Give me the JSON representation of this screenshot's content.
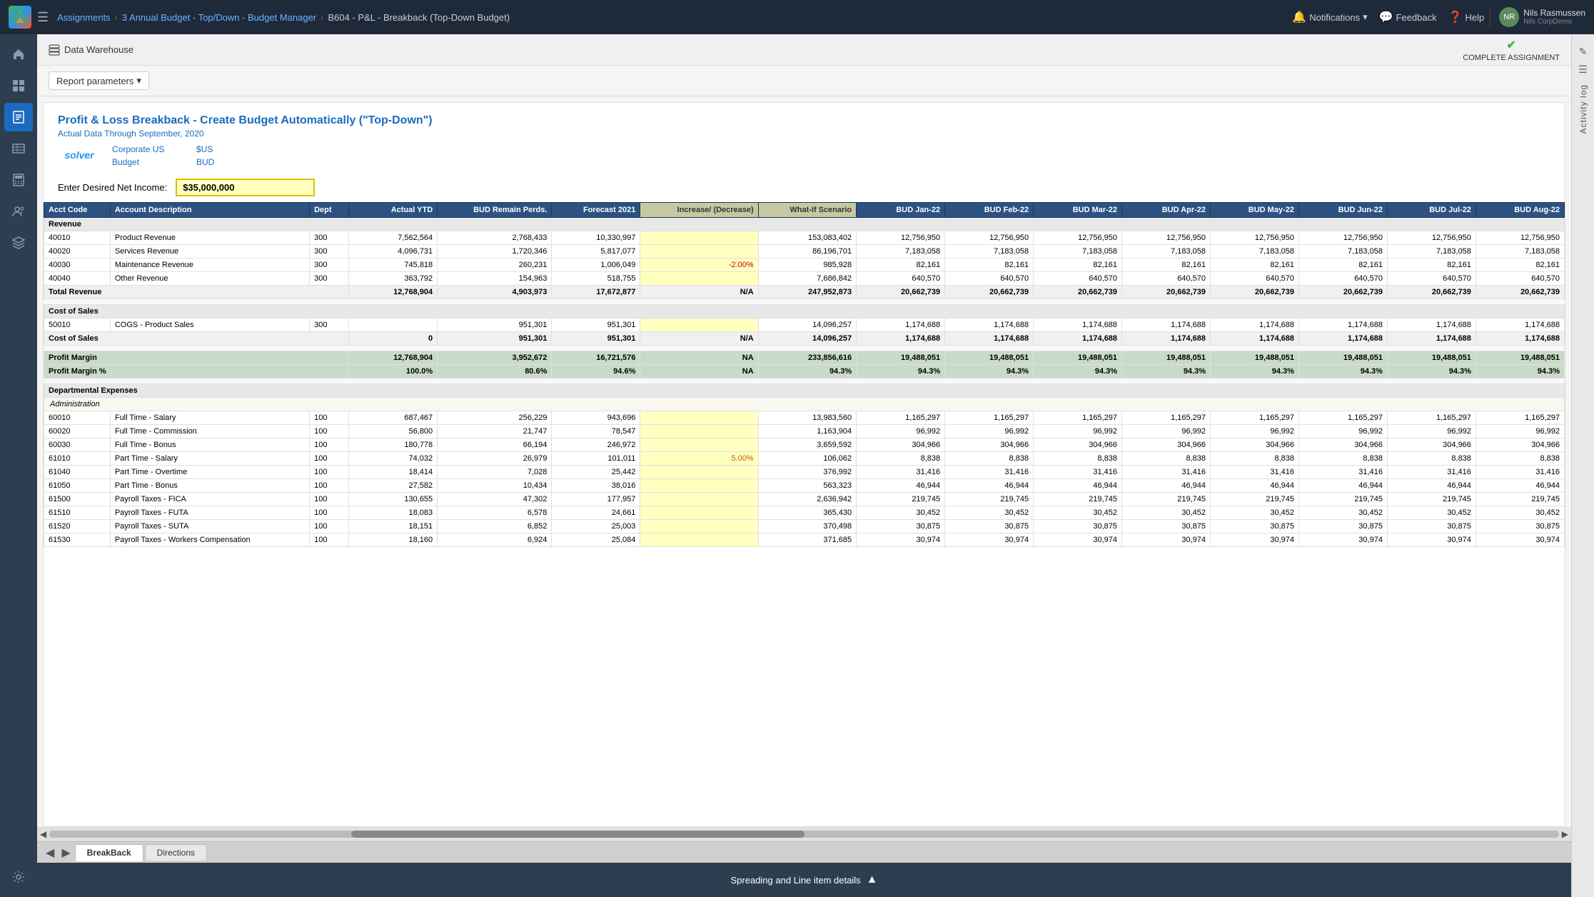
{
  "topnav": {
    "logo_text": "S",
    "hamburger": "☰",
    "breadcrumb": [
      {
        "label": "Assignments",
        "id": "assignments"
      },
      {
        "sep": ">"
      },
      {
        "label": "3 Annual Budget - Top/Down - Budget Manager",
        "id": "budget"
      },
      {
        "sep": ">"
      },
      {
        "label": "B604 - P&L - Breakback (Top-Down Budget)",
        "id": "current"
      }
    ],
    "notifications_label": "Notifications",
    "feedback_label": "Feedback",
    "help_label": "Help",
    "user_name": "Nils Rasmussen",
    "user_org": "Nils CorpDemo"
  },
  "toolbar": {
    "data_warehouse": "Data Warehouse",
    "complete_assignment": "COMPLETE ASSIGNMENT"
  },
  "activity_log": {
    "label": "Activity log"
  },
  "report_params": {
    "label": "Report parameters"
  },
  "report": {
    "title": "Profit & Loss Breakback - Create Budget Automatically (\"Top-Down\")",
    "subtitle": "Actual Data Through September, 2020",
    "company_label": "Corporate US",
    "company_code": "$US",
    "budget_label": "Budget",
    "budget_code": "BUD",
    "net_income_label": "Enter Desired Net Income:",
    "net_income_value": "$35,000,000",
    "columns": {
      "acct_code": "Acct Code",
      "acct_desc": "Account Description",
      "dept": "Dept",
      "actual_ytd": "Actual YTD",
      "bud_remain": "BUD Remain Perds.",
      "forecast_2021": "Forecast 2021",
      "increase_decrease": "Increase/ (Decrease)",
      "what_if": "What-If Scenario",
      "bud_jan22": "BUD Jan-22",
      "bud_feb22": "BUD Feb-22",
      "bud_mar22": "BUD Mar-22",
      "bud_apr22": "BUD Apr-22",
      "bud_may22": "BUD May-22",
      "bud_jun22": "BUD Jun-22",
      "bud_jul22": "BUD Jul-22",
      "bud_aug22": "BUD Aug-22"
    },
    "sections": {
      "revenue": {
        "header": "Revenue",
        "rows": [
          {
            "code": "40010",
            "desc": "Product Revenue",
            "dept": "300",
            "actual_ytd": "7,562,564",
            "bud_remain": "2,768,433",
            "forecast": "10,330,997",
            "increase": "",
            "whatif": "153,083,402",
            "jan": "12,756,950",
            "feb": "12,756,950",
            "mar": "12,756,950",
            "apr": "12,756,950",
            "may": "12,756,950",
            "jun": "12,756,950",
            "jul": "12,756,950",
            "aug": "12,756,950"
          },
          {
            "code": "40020",
            "desc": "Services Revenue",
            "dept": "300",
            "actual_ytd": "4,096,731",
            "bud_remain": "1,720,346",
            "forecast": "5,817,077",
            "increase": "",
            "whatif": "86,196,701",
            "jan": "7,183,058",
            "feb": "7,183,058",
            "mar": "7,183,058",
            "apr": "7,183,058",
            "may": "7,183,058",
            "jun": "7,183,058",
            "jul": "7,183,058",
            "aug": "7,183,058"
          },
          {
            "code": "40030",
            "desc": "Maintenance Revenue",
            "dept": "300",
            "actual_ytd": "745,818",
            "bud_remain": "260,231",
            "forecast": "1,006,049",
            "increase": "-2.00%",
            "whatif": "985,928",
            "jan": "82,161",
            "feb": "82,161",
            "mar": "82,161",
            "apr": "82,161",
            "may": "82,161",
            "jun": "82,161",
            "jul": "82,161",
            "aug": "82,161"
          },
          {
            "code": "40040",
            "desc": "Other Revenue",
            "dept": "300",
            "actual_ytd": "363,792",
            "bud_remain": "154,963",
            "forecast": "518,755",
            "increase": "",
            "whatif": "7,686,842",
            "jan": "640,570",
            "feb": "640,570",
            "mar": "640,570",
            "apr": "640,570",
            "may": "640,570",
            "jun": "640,570",
            "jul": "640,570",
            "aug": "640,570"
          }
        ],
        "total": {
          "label": "Total Revenue",
          "actual_ytd": "12,768,904",
          "bud_remain": "4,903,973",
          "forecast": "17,672,877",
          "increase": "N/A",
          "whatif": "247,952,873",
          "jan": "20,662,739",
          "feb": "20,662,739",
          "mar": "20,662,739",
          "apr": "20,662,739",
          "may": "20,662,739",
          "jun": "20,662,739",
          "jul": "20,662,739",
          "aug": "20,662,739"
        }
      },
      "cost_of_sales": {
        "header": "Cost of Sales",
        "rows": [
          {
            "code": "50010",
            "desc": "COGS - Product Sales",
            "dept": "300",
            "actual_ytd": "",
            "bud_remain": "951,301",
            "forecast": "951,301",
            "increase": "",
            "whatif": "14,096,257",
            "jan": "1,174,688",
            "feb": "1,174,688",
            "mar": "1,174,688",
            "apr": "1,174,688",
            "may": "1,174,688",
            "jun": "1,174,688",
            "jul": "1,174,688",
            "aug": "1,174,688"
          }
        ],
        "total": {
          "label": "Cost of Sales",
          "actual_ytd": "0",
          "bud_remain": "951,301",
          "forecast": "951,301",
          "increase": "N/A",
          "whatif": "14,096,257",
          "jan": "1,174,688",
          "feb": "1,174,688",
          "mar": "1,174,688",
          "apr": "1,174,688",
          "may": "1,174,688",
          "jun": "1,174,688",
          "jul": "1,174,688",
          "aug": "1,174,688"
        }
      },
      "profit_margin": {
        "pm_label": "Profit Margin",
        "pm_actual": "12,768,904",
        "pm_bud": "3,952,672",
        "pm_forecast": "16,721,576",
        "pm_increase": "NA",
        "pm_whatif": "233,856,616",
        "pm_jan": "19,488,051",
        "pm_feb": "19,488,051",
        "pm_mar": "19,488,051",
        "pm_apr": "19,488,051",
        "pm_may": "19,488,051",
        "pm_jun": "19,488,051",
        "pm_jul": "19,488,051",
        "pm_aug": "19,488,051",
        "pmp_label": "Profit Margin %",
        "pmp_actual": "100.0%",
        "pmp_bud": "80.6%",
        "pmp_forecast": "94.6%",
        "pmp_increase": "NA",
        "pmp_whatif": "94.3%",
        "pmp_jan": "94.3%",
        "pmp_feb": "94.3%",
        "pmp_mar": "94.3%",
        "pmp_apr": "94.3%",
        "pmp_may": "94.3%",
        "pmp_jun": "94.3%",
        "pmp_jul": "94.3%",
        "pmp_aug": "94.3%"
      },
      "dept_expenses": {
        "header": "Departmental Expenses",
        "admin_header": "Administration",
        "rows": [
          {
            "code": "60010",
            "desc": "Full Time - Salary",
            "dept": "100",
            "actual_ytd": "687,467",
            "bud_remain": "256,229",
            "forecast": "943,696",
            "increase": "",
            "whatif": "13,983,560",
            "jan": "1,165,297",
            "feb": "1,165,297",
            "mar": "1,165,297",
            "apr": "1,165,297",
            "may": "1,165,297",
            "jun": "1,165,297",
            "jul": "1,165,297",
            "aug": "1,165,297"
          },
          {
            "code": "60020",
            "desc": "Full Time - Commission",
            "dept": "100",
            "actual_ytd": "56,800",
            "bud_remain": "21,747",
            "forecast": "78,547",
            "increase": "",
            "whatif": "1,163,904",
            "jan": "96,992",
            "feb": "96,992",
            "mar": "96,992",
            "apr": "96,992",
            "may": "96,992",
            "jun": "96,992",
            "jul": "96,992",
            "aug": "96,992"
          },
          {
            "code": "60030",
            "desc": "Full Time - Bonus",
            "dept": "100",
            "actual_ytd": "180,778",
            "bud_remain": "66,194",
            "forecast": "246,972",
            "increase": "",
            "whatif": "3,659,592",
            "jan": "304,966",
            "feb": "304,966",
            "mar": "304,966",
            "apr": "304,966",
            "may": "304,966",
            "jun": "304,966",
            "jul": "304,966",
            "aug": "304,966"
          },
          {
            "code": "61010",
            "desc": "Part Time - Salary",
            "dept": "100",
            "actual_ytd": "74,032",
            "bud_remain": "26,979",
            "forecast": "101,011",
            "increase": "5.00%",
            "whatif": "106,062",
            "jan": "8,838",
            "feb": "8,838",
            "mar": "8,838",
            "apr": "8,838",
            "may": "8,838",
            "jun": "8,838",
            "jul": "8,838",
            "aug": "8,838"
          },
          {
            "code": "61040",
            "desc": "Part Time - Overtime",
            "dept": "100",
            "actual_ytd": "18,414",
            "bud_remain": "7,028",
            "forecast": "25,442",
            "increase": "",
            "whatif": "376,992",
            "jan": "31,416",
            "feb": "31,416",
            "mar": "31,416",
            "apr": "31,416",
            "may": "31,416",
            "jun": "31,416",
            "jul": "31,416",
            "aug": "31,416"
          },
          {
            "code": "61050",
            "desc": "Part Time - Bonus",
            "dept": "100",
            "actual_ytd": "27,582",
            "bud_remain": "10,434",
            "forecast": "38,016",
            "increase": "",
            "whatif": "563,323",
            "jan": "46,944",
            "feb": "46,944",
            "mar": "46,944",
            "apr": "46,944",
            "may": "46,944",
            "jun": "46,944",
            "jul": "46,944",
            "aug": "46,944"
          },
          {
            "code": "61500",
            "desc": "Payroll Taxes - FICA",
            "dept": "100",
            "actual_ytd": "130,655",
            "bud_remain": "47,302",
            "forecast": "177,957",
            "increase": "",
            "whatif": "2,636,942",
            "jan": "219,745",
            "feb": "219,745",
            "mar": "219,745",
            "apr": "219,745",
            "may": "219,745",
            "jun": "219,745",
            "jul": "219,745",
            "aug": "219,745"
          },
          {
            "code": "61510",
            "desc": "Payroll Taxes - FUTA",
            "dept": "100",
            "actual_ytd": "18,083",
            "bud_remain": "6,578",
            "forecast": "24,661",
            "increase": "",
            "whatif": "365,430",
            "jan": "30,452",
            "feb": "30,452",
            "mar": "30,452",
            "apr": "30,452",
            "may": "30,452",
            "jun": "30,452",
            "jul": "30,452",
            "aug": "30,452"
          },
          {
            "code": "61520",
            "desc": "Payroll Taxes - SUTA",
            "dept": "100",
            "actual_ytd": "18,151",
            "bud_remain": "6,852",
            "forecast": "25,003",
            "increase": "",
            "whatif": "370,498",
            "jan": "30,875",
            "feb": "30,875",
            "mar": "30,875",
            "apr": "30,875",
            "may": "30,875",
            "jun": "30,875",
            "jul": "30,875",
            "aug": "30,875"
          },
          {
            "code": "61530",
            "desc": "Payroll Taxes - Workers Compensation",
            "dept": "100",
            "actual_ytd": "18,160",
            "bud_remain": "6,924",
            "forecast": "25,084",
            "increase": "",
            "whatif": "371,685",
            "jan": "30,974",
            "feb": "30,974",
            "mar": "30,974",
            "apr": "30,974",
            "may": "30,974",
            "jun": "30,974",
            "jul": "30,974",
            "aug": "30,974"
          }
        ]
      }
    }
  },
  "tabs": {
    "breakback": "BreakBack",
    "directions": "Directions"
  },
  "bottom_bar": {
    "label": "Spreading and Line item details"
  },
  "sidebar_icons": [
    {
      "name": "home",
      "symbol": "⌂",
      "active": false
    },
    {
      "name": "chart",
      "symbol": "📊",
      "active": false
    },
    {
      "name": "list",
      "symbol": "☰",
      "active": true
    },
    {
      "name": "table",
      "symbol": "⊞",
      "active": false
    },
    {
      "name": "calculator",
      "symbol": "#",
      "active": false
    },
    {
      "name": "person",
      "symbol": "👤",
      "active": false
    },
    {
      "name": "layers",
      "symbol": "◫",
      "active": false
    },
    {
      "name": "settings",
      "symbol": "⚙",
      "active": false
    }
  ]
}
